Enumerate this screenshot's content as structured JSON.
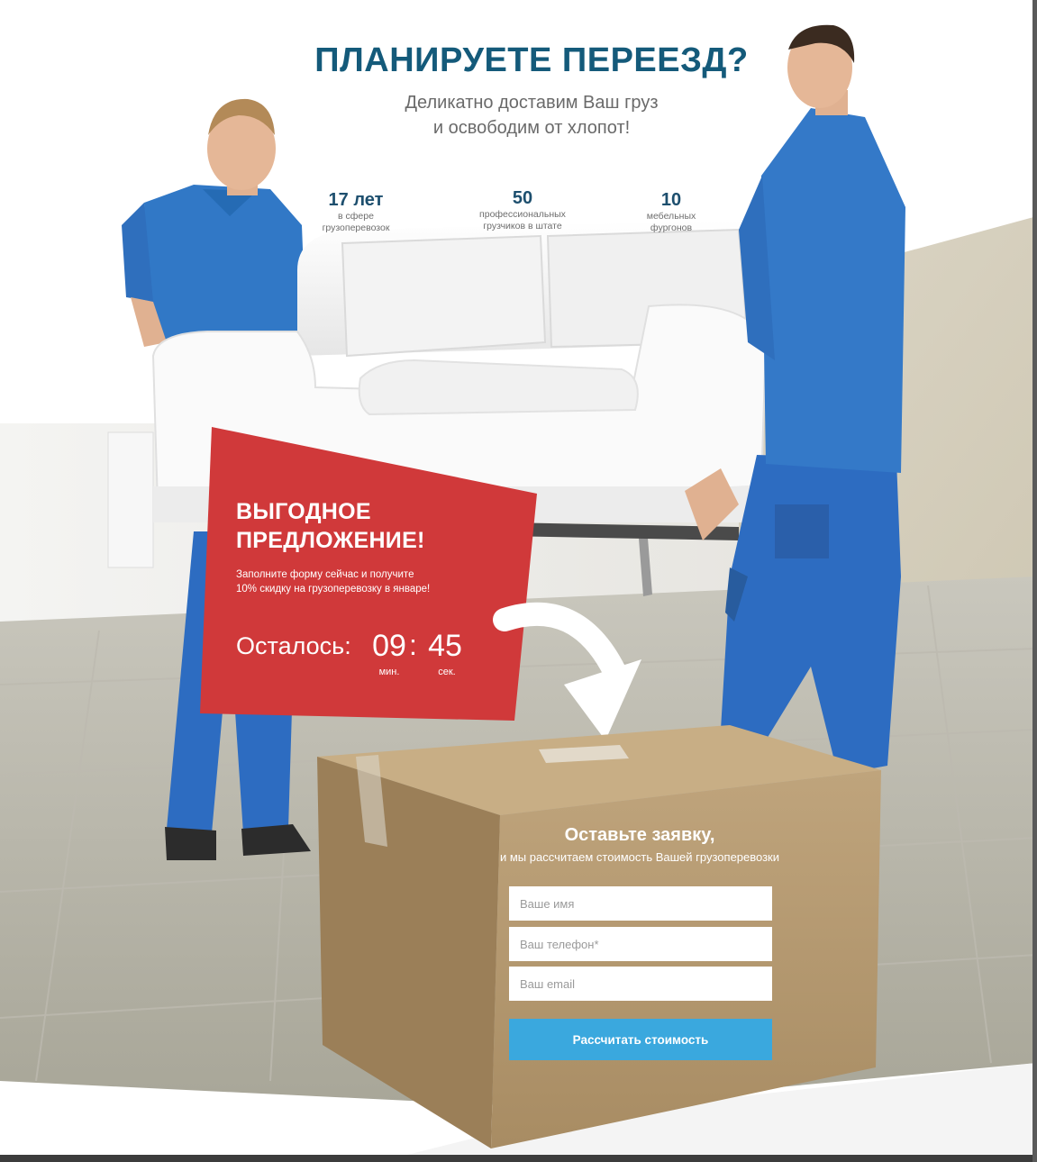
{
  "hero": {
    "title": "ПЛАНИРУЕТЕ ПЕРЕЕЗД?",
    "subtitle_line1": "Деликатно доставим Ваш груз",
    "subtitle_line2": "и освободим от хлопот!"
  },
  "stats": [
    {
      "value": "17 лет",
      "caption_line1": "в сфере",
      "caption_line2": "грузоперевозок"
    },
    {
      "value": "50",
      "caption_line1": "профессиональных",
      "caption_line2": "грузчиков в штате"
    },
    {
      "value": "10",
      "caption_line1": "мебельных",
      "caption_line2": "фургонов"
    }
  ],
  "offer": {
    "title_line1": "ВЫГОДНОЕ",
    "title_line2": "ПРЕДЛОЖЕНИЕ!",
    "text_line1": "Заполните форму сейчас и получите",
    "text_line2": "10% скидку на грузоперевозку в январе!",
    "timer_label": "Осталось:",
    "minutes": "09",
    "separator": ":",
    "seconds": "45",
    "minutes_caption": "мин.",
    "seconds_caption": "сек.",
    "color": "#d0393a"
  },
  "form": {
    "title": "Оставьте заявку,",
    "subtitle": "и мы рассчитаем стоимость Вашей грузоперевозки",
    "name_placeholder": "Ваше имя",
    "phone_placeholder": "Ваш телефон*",
    "email_placeholder": "Ваш email",
    "submit_label": "Рассчитать стоимость",
    "button_color": "#3aa8de"
  },
  "colors": {
    "title": "#145a7a",
    "uniform_blue": "#2f6fc0",
    "box_brown": "#b89b72"
  }
}
